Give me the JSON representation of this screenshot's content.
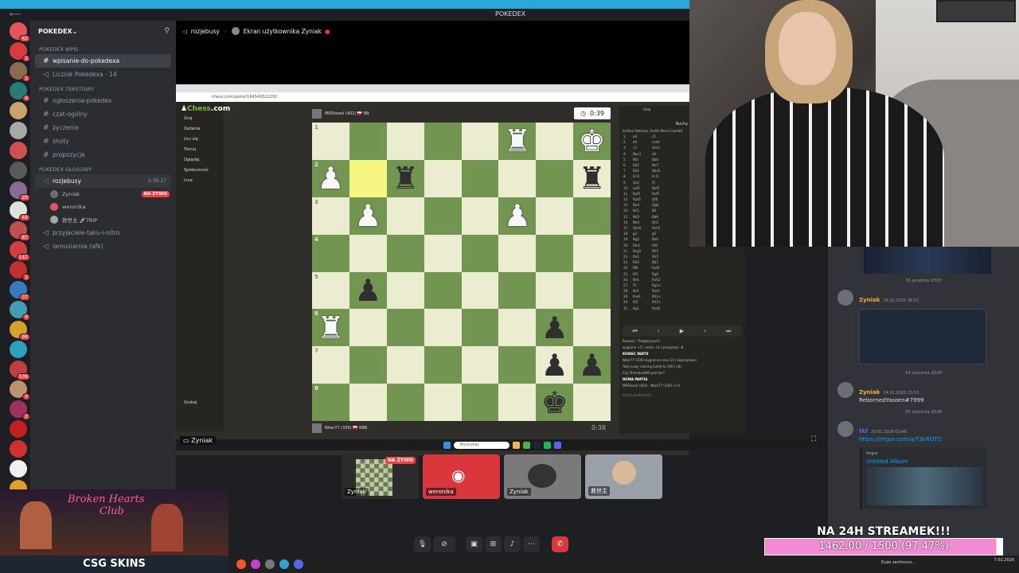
{
  "window": {
    "title": "POKEDEX"
  },
  "colors": {
    "accent": "#2aa9d9",
    "live": "#f23f43",
    "board_light": "#ebecd0",
    "board_dark": "#739552",
    "highlight": "#f5f682",
    "goal_bar": "#f38bd3"
  },
  "servers": [
    {
      "badge": "42",
      "color": "#e7555a"
    },
    {
      "badge": "1",
      "color": "#d83c3e"
    },
    {
      "badge": "1",
      "color": "#8c6b4f"
    },
    {
      "badge": "4",
      "color": "#2a7a7a"
    },
    {
      "badge": "",
      "color": "#c9a36b"
    },
    {
      "badge": "",
      "color": "#a8a8a8"
    },
    {
      "badge": "",
      "color": "#d05050"
    },
    {
      "badge": "",
      "color": "#5a5a5a"
    },
    {
      "badge": "20",
      "color": "#8a6a9a"
    },
    {
      "badge": "44",
      "color": "#e0e0e0"
    },
    {
      "badge": "87",
      "color": "#c05050"
    },
    {
      "badge": "147",
      "color": "#d04040"
    },
    {
      "badge": "1",
      "color": "#c03030"
    },
    {
      "badge": "37",
      "color": "#3a7ac0"
    },
    {
      "badge": "4",
      "color": "#40a0b0"
    },
    {
      "badge": "96",
      "color": "#d4a030"
    },
    {
      "badge": "",
      "color": "#30a0c0"
    },
    {
      "badge": "539",
      "color": "#c04040"
    },
    {
      "badge": "4",
      "color": "#c09070"
    },
    {
      "badge": "2",
      "color": "#a03060"
    },
    {
      "badge": "",
      "color": "#c02020"
    },
    {
      "badge": "",
      "color": "#d03030"
    },
    {
      "badge": "",
      "color": "#f0f0f0"
    },
    {
      "badge": "",
      "color": "#e0a030"
    },
    {
      "badge": "",
      "color": "#4a8a4a"
    }
  ],
  "sidebar": {
    "guild": "POKEDEX",
    "cat1": "POKEDEX Wpis",
    "ch_wpis": "wpisanie-do-pokedexa",
    "ch_licznik": "Licznik Pokedexa - 14",
    "cat2": "POKEDEX Tekstowy",
    "text_channels": [
      "ogłoszenia-pokedex",
      "czat-ogólny",
      "życzenia",
      "shoty",
      "propozycje"
    ],
    "cat3": "POKEDEX GŁOSOWY",
    "voice_channel": "rozjebusy",
    "voice_time": "2:36:17",
    "users": [
      {
        "name": "Zyniak",
        "live": "NA ŻYWO",
        "color": "#6d6f78"
      },
      {
        "name": "weronika",
        "live": "",
        "color": "#e7555a"
      },
      {
        "name": "救世主 🚀7RIP",
        "live": "",
        "color": "#a8a8a8"
      }
    ],
    "voice_others": [
      "przyjaciele-taku-i-nitro",
      "lamusiarnia (afk)"
    ]
  },
  "stream_header": {
    "channel": "rozjebusy",
    "user_screen": "Ekran użytkownika Zyniak"
  },
  "browser": {
    "url": "chess.com/game/164549522292"
  },
  "chess": {
    "nav": [
      "Graj",
      "Zadania",
      "Ucz się",
      "Trenuj",
      "Oglądaj",
      "Społeczność",
      "Inne"
    ],
    "search": "Szukaj",
    "top_player": "MRSheesl (402) 🇵🇱 BB",
    "top_clock": "0:39",
    "bottom_player": "Niter77 (330) 🇵🇱 BBB",
    "bottom_clock": "0:38",
    "opening": "Sicilian Defense: Smith-Morra Gambit",
    "tabs": [
      "Graj",
      "Nowa partia"
    ],
    "moves_tab": "Ruchy",
    "moves": [
      [
        "1.",
        "e4",
        "c5"
      ],
      [
        "2.",
        "d4",
        "cxd4"
      ],
      [
        "3.",
        "c3",
        "dxc3"
      ],
      [
        "4.",
        "Nxc3",
        "e6"
      ],
      [
        "5.",
        "Nf3",
        "Bb4"
      ],
      [
        "6.",
        "Bd2",
        "Ne7"
      ],
      [
        "7.",
        "Bd3",
        "Nbc6"
      ],
      [
        "8.",
        "O-O",
        "O-O"
      ],
      [
        "9.",
        "Qe2",
        "f5"
      ],
      [
        "10.",
        "exf5",
        "Nxf5"
      ],
      [
        "11.",
        "Bxf5",
        "Rxf5"
      ],
      [
        "12.",
        "Rad1",
        "Qf6"
      ],
      [
        "13.",
        "Ne4",
        "Qg6"
      ],
      [
        "14.",
        "Nc5",
        "b6"
      ],
      [
        "15.",
        "Nd3",
        "Bd6"
      ],
      [
        "16.",
        "Nh4",
        "Qh5"
      ],
      [
        "17.",
        "Qxh5",
        "Rxh5"
      ],
      [
        "18.",
        "g3",
        "g5"
      ],
      [
        "19.",
        "Ng2",
        "Ba6"
      ],
      [
        "20.",
        "Rfe1",
        "Rf8"
      ],
      [
        "21.",
        "Bxg5",
        "Rh3"
      ],
      [
        "22.",
        "Re3",
        "Rh5"
      ],
      [
        "23.",
        "Rd2",
        "Bb7"
      ],
      [
        "24.",
        "Bf6",
        "Rxf6"
      ],
      [
        "25.",
        "Kf1",
        "Rg6"
      ],
      [
        "26.",
        "Ne1",
        "Rxh2"
      ],
      [
        "27.",
        "f3",
        "Rg1+"
      ],
      [
        "28.",
        "Ke2",
        "Rxe1"
      ],
      [
        "29.",
        "Kxe1",
        "Rh1+"
      ],
      [
        "30.",
        "Kf2",
        "Rh2+"
      ],
      [
        "31.",
        "Kg1",
        "Rxd2"
      ]
    ],
    "rematch": "Rewanż",
    "analysis": "Podgląd partii",
    "result_line": "wygrane +5 / remis +0 / przegrane -8",
    "end_title": "KONIEC PARTII",
    "end_text": "Niter77 (330) wygrał na czas (2:1 zwycięstwo)",
    "end_text2": "Twój nowy ranking bullet to 330 (+8).",
    "chat_line": "Czy Shinobuta99 grał fair?",
    "new_game": "NOWA PARTIA",
    "new_game_line": "MRSheesl (402) · Niter77 (330) 1+0",
    "chat_placeholder": "Wyślij wiadomość...",
    "files": [
      "h",
      "g",
      "f",
      "e",
      "d",
      "c",
      "b",
      "a"
    ],
    "ranks": [
      "1",
      "2",
      "3",
      "4",
      "5",
      "6",
      "7",
      "8"
    ]
  },
  "pieces": [
    {
      "sq": "a1",
      "p": "♚",
      "c": "w"
    },
    {
      "sq": "c1",
      "p": "♜",
      "c": "w"
    },
    {
      "sq": "a2",
      "p": "♜",
      "c": "b"
    },
    {
      "sq": "f2",
      "p": "♜",
      "c": "b"
    },
    {
      "sq": "h2",
      "p": "♟",
      "c": "w"
    },
    {
      "sq": "c3",
      "p": "♟",
      "c": "w"
    },
    {
      "sq": "g3",
      "p": "♟",
      "c": "w"
    },
    {
      "sq": "g5",
      "p": "♟",
      "c": "b"
    },
    {
      "sq": "b6",
      "p": "♟",
      "c": "b"
    },
    {
      "sq": "h6",
      "p": "♜",
      "c": "w"
    },
    {
      "sq": "a7",
      "p": "♟",
      "c": "b"
    },
    {
      "sq": "b7",
      "p": "♟",
      "c": "b"
    },
    {
      "sq": "b8",
      "p": "♚",
      "c": "b"
    }
  ],
  "stream_label": "Zyniak",
  "taskbar": {
    "search": "Wyszukaj"
  },
  "tiles": [
    {
      "name": "Zyniak",
      "live": "NA ŻYWO",
      "bg": "#2b2b2b"
    },
    {
      "name": "weronika",
      "live": "",
      "bg": "#da373c"
    },
    {
      "name": "Zyniak",
      "live": "",
      "bg": "#7a7a7a"
    },
    {
      "name": "救世主",
      "live": "",
      "bg": "#9aa0a8"
    }
  ],
  "controls": [
    "mic",
    "camera",
    "screen",
    "activity",
    "soundboard",
    "more"
  ],
  "chat": {
    "date1": "16 grudnia 2025",
    "m1_user": "Zyniak",
    "m1_time": "16.12.2025 18:52",
    "date2": "14 stycznia 2026",
    "m2_user": "Zyniak",
    "m2_time": "14.01.2026 23:53",
    "m2_text": "RebornedYasoen#7999",
    "date3": "20 stycznia 2026",
    "m3_user": "tkf",
    "m3_time": "20.01.2026 03:48",
    "m3_link": "https://imgur.com/a/T3kROTD",
    "embed_provider": "Imgur",
    "embed_title": "Untitled Album"
  },
  "goal": {
    "heading": "NA 24H STREAMEK!!!",
    "progress_text": "1462.00 / 1500 (97.47%)",
    "progress_fraction": 0.9747
  },
  "banner": {
    "line1": "Broken Hearts",
    "line2": "Club",
    "sponsor": "CSG SKINS"
  },
  "windows_tray": {
    "weather": "Duże zachmurz...",
    "time": "",
    "date": "7.02.2026"
  }
}
